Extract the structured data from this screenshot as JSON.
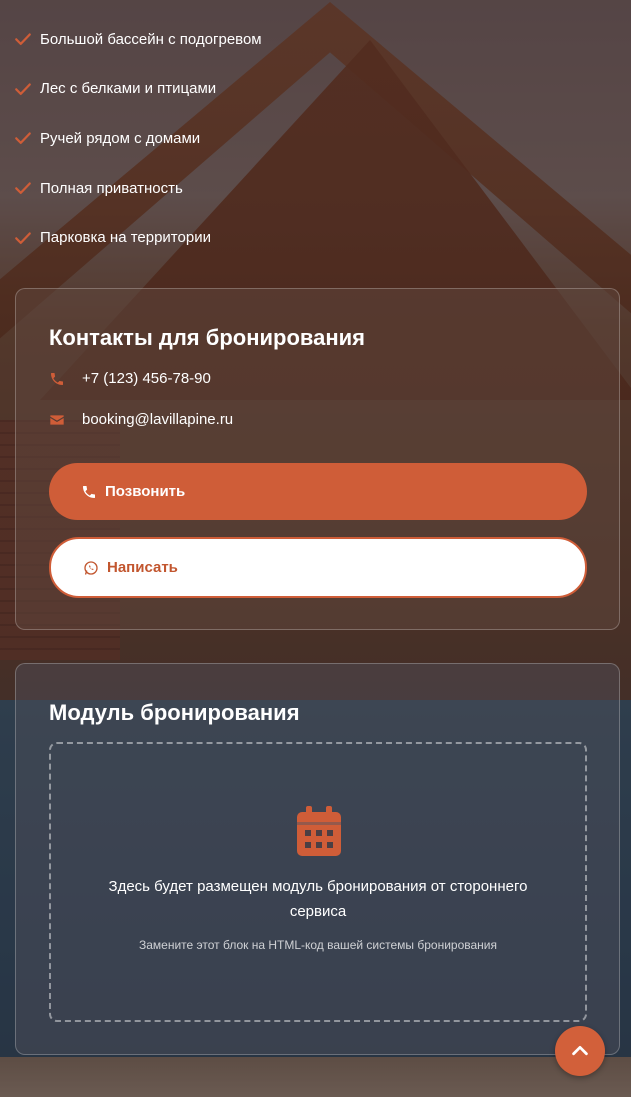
{
  "features": [
    "Большой бассейн с подогревом",
    "Лес с белками и птицами",
    "Ручей рядом с домами",
    "Полная приватность",
    "Парковка на территории"
  ],
  "contacts": {
    "title": "Контакты для бронирования",
    "phone": "+7 (123) 456-78-90",
    "email": "booking@lavillapine.ru",
    "call_label": "Позвонить",
    "write_label": "Написать"
  },
  "booking_module": {
    "title": "Модуль бронирования",
    "message": "Здесь будет размещен модуль бронирования от стороннего сервиса",
    "hint": "Замените этот блок на HTML-код вашей системы бронирования"
  },
  "icons": {
    "feature": "check-icon",
    "phone": "phone-icon",
    "email": "envelope-icon",
    "whatsapp": "whatsapp-icon",
    "calendar": "calendar-icon",
    "scroll_top": "chevron-up-icon"
  },
  "colors": {
    "accent": "#cf5d38",
    "text": "#ffffff"
  }
}
